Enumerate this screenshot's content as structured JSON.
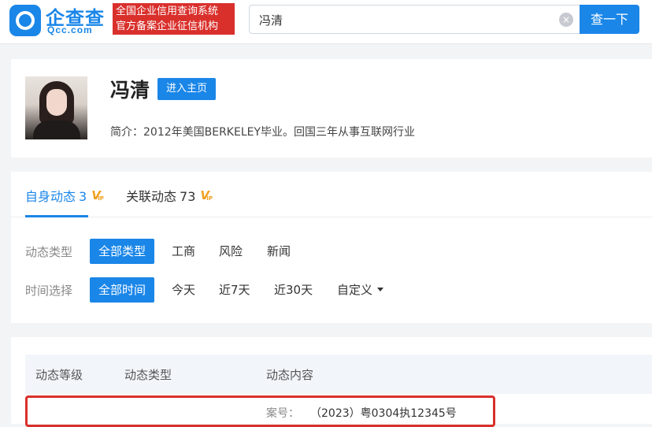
{
  "header": {
    "logo_cn": "企查查",
    "logo_en": "Qcc.com",
    "slogan_line1": "全国企业信用查询系统",
    "slogan_line2": "官方备案企业征信机构",
    "search_value": "冯清",
    "clear_icon": "×",
    "search_button": "查一下"
  },
  "profile": {
    "name": "冯清",
    "home_button": "进入主页",
    "intro": "简介：2012年美国BERKELEY毕业。回国三年从事互联网行业"
  },
  "tabs": [
    {
      "label": "自身动态",
      "count": "3",
      "active": true
    },
    {
      "label": "关联动态",
      "count": "73",
      "active": false
    }
  ],
  "vip": {
    "v": "V",
    "ip": "IP"
  },
  "filters": {
    "type_label": "动态类型",
    "type_options": [
      "全部类型",
      "工商",
      "风险",
      "新闻"
    ],
    "time_label": "时间选择",
    "time_options": [
      "全部时间",
      "今天",
      "近7天",
      "近30天",
      "自定义"
    ]
  },
  "table": {
    "headers": [
      "动态等级",
      "动态类型",
      "动态内容"
    ],
    "case_label": "案号：",
    "case_value": "（2023）粤0304执12345号"
  },
  "colors": {
    "accent": "#1a86e8",
    "brand_red": "#d9302c",
    "vip": "#f0a020"
  }
}
